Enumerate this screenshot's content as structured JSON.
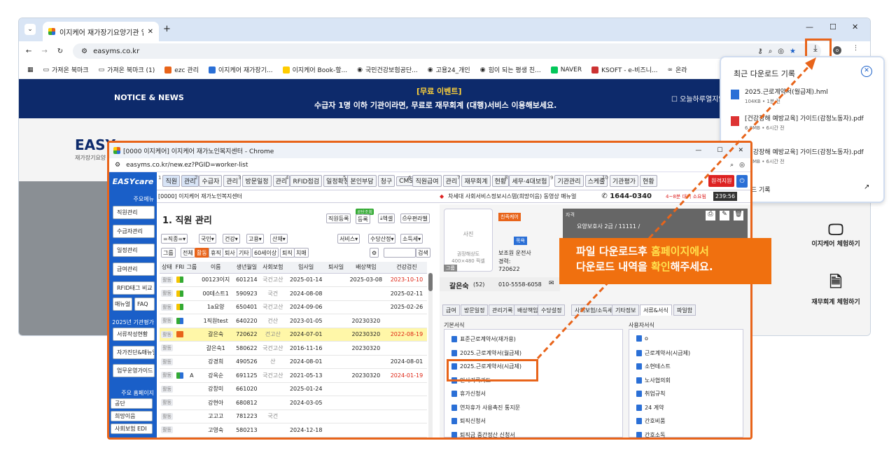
{
  "browser": {
    "tab_title": "이지케어 재가장기요양기관 입",
    "url": "easyms.co.kr",
    "bookmarks": [
      "가져온 북마크",
      "가져온 북마크 (1)",
      "ezc 관리",
      "이지케어 재가장기...",
      "이지케어 Book-할...",
      "국민건강보험공단...",
      "고용24_개인",
      "힘이 되는 평생 친...",
      "NAVER",
      "KSOFT - e-비즈니...",
      "온라"
    ]
  },
  "banner": {
    "left": "NOTICE & NEWS",
    "event": "[무료 이벤트]",
    "text": "수급자 1명 이하 기관이라면, 무료로 재무회계 (대행)서비스 이용해보세요.",
    "right": "오늘하루열지않"
  },
  "site": {
    "logo": "EASY",
    "logo_sub": "재가장기요양"
  },
  "downloads": {
    "title": "최근 다운로드 기록",
    "items": [
      {
        "name": "2025.근로계약서(월급제).hml",
        "meta": "104KB • 1분 전"
      },
      {
        "name": "[건강장해 예방교육] 가이드(감정노동자).pdf",
        "meta": "6.0MB • 6시간 전"
      },
      {
        "name": "[건강장해 예방교육] 가이드(감정노동자).pdf",
        "meta": "6.0MB • 6시간 전"
      }
    ],
    "footer": "다운로드 기록"
  },
  "promo": {
    "item1": "이지케어 체험하기",
    "item2": "재무회계 체험하기"
  },
  "inner": {
    "window_title": "[0000 이지케어] 이지케어 재가노인복지센터 - Chrome",
    "url": "easyms.co.kr/new.ez?PGID=worker-list",
    "logo": "EASYcare",
    "menu": [
      {
        "n": "1",
        "a": "직원",
        "b": "관리"
      },
      {
        "n": "2",
        "a": "수급자",
        "b": "관리"
      },
      {
        "n": "3",
        "a": "방문일정",
        "b": "관리"
      },
      {
        "n": "4",
        "a": "RFID점검",
        "b": "일정확정"
      },
      {
        "n": "5",
        "a": "본인부담",
        "b": "청구",
        "c": "CMS"
      },
      {
        "n": "6",
        "a": "직원급여",
        "b": "관리"
      },
      {
        "n": "7",
        "a": "재무회계",
        "b": "현황"
      },
      {
        "n": "8",
        "a": "세무·4대보험",
        "b": ""
      },
      {
        "n": "9",
        "a": "기관관리",
        "b": "스케줄"
      },
      {
        "n": "10",
        "a": "기관평가",
        "b": "현황"
      }
    ],
    "remote": "원격지원",
    "org": "[0000] 이지케어 재가노인복지센터",
    "notice": "차세대 사회서비스정보시스템(희망이음) 동영상 매뉴얼",
    "phone": "1644-0340",
    "phone_note": "4~8분 대기 소요됨",
    "timer": "239:56",
    "sidebar": {
      "main_label": "주요메뉴",
      "items": [
        "직원관리",
        "수급자관리",
        "일정관리",
        "급여관리",
        "RFID태그 비교",
        "매뉴얼",
        "FAQ"
      ],
      "eval_label": "2025년 기관평가",
      "eval_items": [
        "서류작성현황",
        "자가진단&매뉴얼",
        "업무운영가이드"
      ],
      "home_label": "주요 홈페이지",
      "home_items": [
        "공단",
        "희망이음",
        "사회보험 EDI"
      ]
    },
    "list": {
      "title": "1. 직원 관리",
      "btn_register": "직원등록",
      "btn_public": "공단조회",
      "btn_reg2": "등록",
      "btn_excel": "엑셀",
      "btn_print": "우편라벨",
      "filters": [
        "=직종=",
        "국민",
        "건강",
        "고용",
        "산재"
      ],
      "filters_right": [
        "서비스",
        "수당산정",
        "소득세"
      ],
      "groups": [
        "그룹",
        "전체",
        "활동",
        "휴직",
        "퇴사",
        "기타",
        "60세이상",
        "퇴직",
        "치매"
      ],
      "search": "검색",
      "columns": [
        "상태",
        "FRI",
        "그룹",
        "이름",
        "생년월일",
        "사회보험",
        "입사일",
        "퇴사일",
        "배상책임",
        "건강검진"
      ],
      "rows": [
        {
          "st": "활동",
          "rf": "y",
          "g": "",
          "name": "00123이지",
          "birth": "601214",
          "ins": "국건고산",
          "join": "2025-01-14",
          "leave": "",
          "liab": "2025-03-08",
          "health": "2023-10-10",
          "hred": true,
          "hl": false
        },
        {
          "st": "활동",
          "rf": "y",
          "g": "",
          "name": "00테스트1",
          "birth": "590923",
          "ins": "국건",
          "join": "2024-08-08",
          "leave": "",
          "liab": "",
          "health": "2025-02-11",
          "hred": false,
          "hl": false
        },
        {
          "st": "활동",
          "rf": "y",
          "g": "",
          "name": "1a요양",
          "birth": "650401",
          "ins": "국건고산",
          "join": "2024-09-06",
          "leave": "",
          "liab": "",
          "health": "2025-02-26",
          "hred": false,
          "hl": false
        },
        {
          "st": "활동",
          "rf": "g",
          "g": "",
          "name": "1직원test",
          "birth": "640220",
          "ins": "건산",
          "join": "2023-01-05",
          "leave": "",
          "liab": "20230320",
          "health": "",
          "hred": false,
          "hl": false
        },
        {
          "st": "활동",
          "rf": "o",
          "g": "",
          "name": "갈은숙",
          "birth": "720622",
          "ins": "건고산",
          "join": "2024-07-01",
          "leave": "",
          "liab": "20230320",
          "health": "2022-08-19",
          "hred": true,
          "hl": true
        },
        {
          "st": "활동",
          "rf": "",
          "g": "",
          "name": "갈은숙1",
          "birth": "580622",
          "ins": "국건고산",
          "join": "2016-11-16",
          "leave": "",
          "liab": "20230320",
          "health": "",
          "hred": false,
          "hl": false
        },
        {
          "st": "활동",
          "rf": "",
          "g": "",
          "name": "강경희",
          "birth": "490526",
          "ins": "산",
          "join": "2024-08-01",
          "leave": "",
          "liab": "",
          "health": "2024-08-01",
          "hred": false,
          "hl": false
        },
        {
          "st": "활동",
          "rf": "g",
          "g": "A",
          "name": "강옥순",
          "birth": "691125",
          "ins": "국건고산",
          "join": "2021-05-13",
          "leave": "",
          "liab": "20230320",
          "health": "2024-01-19",
          "hred": true,
          "hl": false
        },
        {
          "st": "활동",
          "rf": "",
          "g": "",
          "name": "강창미",
          "birth": "661020",
          "ins": "",
          "join": "2025-01-24",
          "leave": "",
          "liab": "",
          "health": "",
          "hred": false,
          "hl": false
        },
        {
          "st": "활동",
          "rf": "",
          "g": "",
          "name": "강현아",
          "birth": "680812",
          "ins": "",
          "join": "2024-03-05",
          "leave": "",
          "liab": "",
          "health": "",
          "hred": false,
          "hl": false
        },
        {
          "st": "활동",
          "rf": "",
          "g": "",
          "name": "고고고",
          "birth": "781223",
          "ins": "국건",
          "join": "",
          "leave": "",
          "liab": "",
          "health": "",
          "hred": false,
          "hl": false
        },
        {
          "st": "활동",
          "rf": "",
          "g": "",
          "name": "고영숙",
          "birth": "580213",
          "ins": "",
          "join": "2024-12-18",
          "leave": "",
          "liab": "",
          "health": "",
          "hred": false,
          "hl": false
        }
      ]
    },
    "detail": {
      "photo": "사진",
      "photo_hint1": "권장해상도",
      "photo_hint2": "400×480 픽셀",
      "photo_group": "그룹",
      "badge1": "친족케어",
      "badge2": "목욕",
      "job": "보조원 운전사",
      "career_label": "경력:",
      "career": "720622",
      "name": "갈은숙",
      "age": "(52)",
      "phone": "010-5558-6058",
      "cert_label": "자격",
      "cert": "요양보호사 2급 / 11111 /",
      "tabs": [
        "급여",
        "방문일정",
        "관리기록",
        "배상책임",
        "수당설정",
        "사회보험/소득세",
        "기타정보",
        "서류&서식",
        "파일함"
      ],
      "basic_title": "기본서식",
      "basic": [
        "표준근로계약서(재가용)",
        "2025.근로계약서(월급제)",
        "2025.근로계약서(시급제)",
        "인사기록카드",
        "휴가신청서",
        "연차휴가 사용촉진 통지문",
        "퇴직신청서",
        "퇴직금 중간정산 신청서"
      ],
      "user_title": "사용자서식",
      "user": [
        "o",
        "근로계약서(시급제)",
        "소현테스트",
        "노사협의회",
        "취업규칙",
        "24 계약",
        "간호비품",
        "간호소독"
      ]
    }
  },
  "callout": {
    "l1a": "파일 다운로드후 ",
    "l1b": "홈페이지에서",
    "l2a": "다운로드 내역을 ",
    "l2b": "확인",
    "l2c": "해주세요."
  },
  "colors": {
    "accent": "#e8641a",
    "brand": "#1a5fc8",
    "navy": "#0d2a6b"
  }
}
